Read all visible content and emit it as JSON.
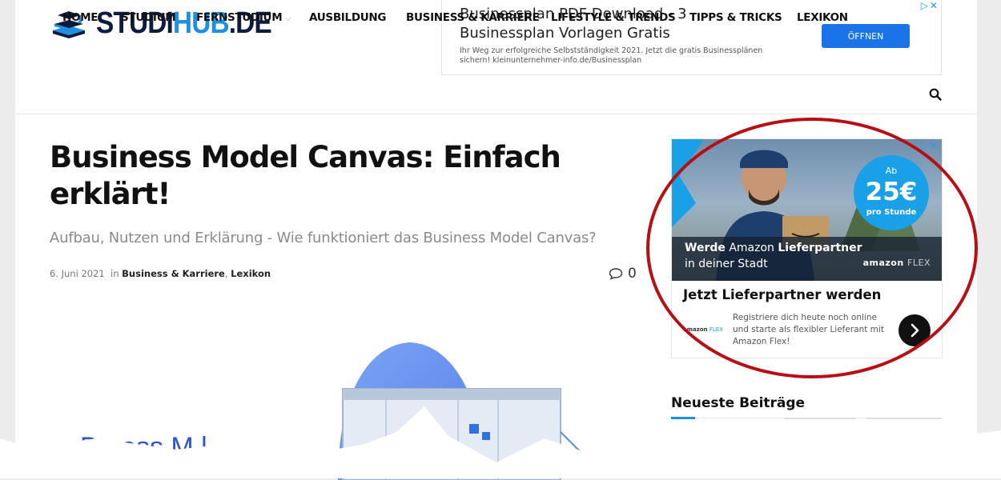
{
  "brand": {
    "logo_part1": "STUDI",
    "logo_part2": "HUB",
    "logo_part3": ".DE"
  },
  "top_ad": {
    "headline": "Businessplan PDF Download - 3 Businessplan Vorlagen Gratis",
    "sub": "Ihr Weg zur erfolgreiche Selbstständigkeit 2021. Jetzt die gratis Businessplänen sichern! kleinunternehmer-info.de/Businessplan",
    "button": "ÖFFNEN",
    "adchoice": "▷✕"
  },
  "nav": {
    "items": [
      {
        "label": "HOME"
      },
      {
        "label": "STUDIUM"
      },
      {
        "label": "FERNSTUDIUM",
        "chevron": "⌵"
      },
      {
        "label": "AUSBILDUNG"
      },
      {
        "label": "BUSINESS & KARRIERE"
      },
      {
        "label": "LIFESTYLE & TRENDS"
      },
      {
        "label": "TIPPS & TRICKS"
      },
      {
        "label": "LEXIKON"
      }
    ]
  },
  "article": {
    "title": "Business Model Canvas: Einfach erklärt!",
    "subtitle": "Aufbau, Nutzen und Erklärung - Wie funktioniert das Business Model Canvas?",
    "date": "6. Juni 2021",
    "in": "in",
    "category1": "Business & Karriere",
    "sep": ",",
    "category2": "Lexikon",
    "comment_count": "0",
    "hero_text": "Bu    ess M    l"
  },
  "side_ad": {
    "badge_top": "Ab",
    "badge_price": "25€",
    "badge_sub": "pro Stunde",
    "line1_a": "Werde",
    "line1_b": "Amazon",
    "line1_c": "Lieferpartner",
    "line2": "in deiner Stadt",
    "brand_a": "amazon",
    "brand_b": "FLEX",
    "cta": "Jetzt Lieferpartner werden",
    "desc": "Registriere dich heute noch online und starte als flexibler Lieferant mit Amazon Flex!",
    "adchoice": "▷✕"
  },
  "sidebar": {
    "recent_title": "Neueste Beiträge"
  },
  "colors": {
    "brand_dark": "#0d1b3e",
    "brand_blue": "#1e8fe1",
    "ring_red": "#b70f14",
    "ad_blue": "#1a73e8"
  }
}
